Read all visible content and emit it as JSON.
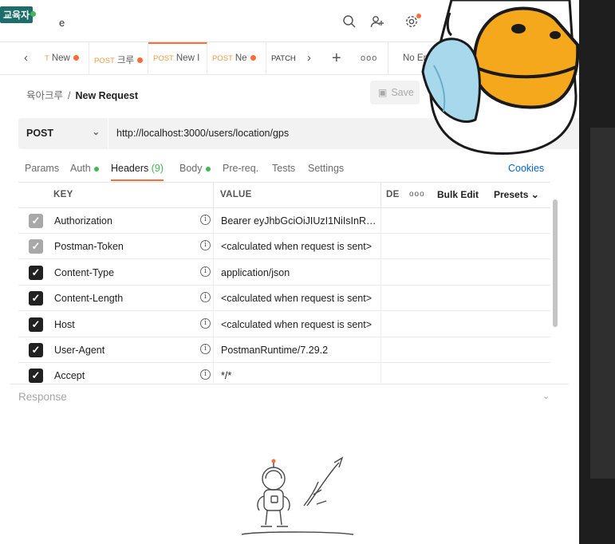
{
  "topbar": {
    "badge": "교육자",
    "title": "e",
    "icons": [
      "search-icon",
      "add-user-icon",
      "settings-icon"
    ]
  },
  "tabs": {
    "items": [
      {
        "method": "T",
        "title": "New",
        "dirty": true
      },
      {
        "method": "POST",
        "title": "크루",
        "dirty": true
      },
      {
        "method": "POST",
        "title": "New I",
        "dirty": false,
        "active": true
      },
      {
        "method": "POST",
        "title": "Ne",
        "dirty": true
      },
      {
        "method": "PATCH",
        "title": "",
        "dirty": false
      }
    ],
    "env_label": "No Env"
  },
  "breadcrumb": {
    "collection": "육아크루",
    "separator": "/",
    "current": "New Request"
  },
  "save_label": "Save",
  "request": {
    "method": "POST",
    "url": "http://localhost:3000/users/location/gps"
  },
  "request_tabs": [
    {
      "label": "Params"
    },
    {
      "label": "Auth",
      "dot": true
    },
    {
      "label": "Headers",
      "count": "(9)",
      "active": true
    },
    {
      "label": "Body",
      "dot": true
    },
    {
      "label": "Pre-req."
    },
    {
      "label": "Tests"
    },
    {
      "label": "Settings"
    }
  ],
  "cookies_label": "Cookies",
  "headers_table": {
    "columns": [
      "KEY",
      "VALUE",
      "DES"
    ],
    "bulk_edit": "Bulk Edit",
    "presets": "Presets",
    "rows": [
      {
        "key": "Authorization",
        "value": "Bearer eyJhbGciOiJIUzI1NiIsInR5...",
        "checked": true,
        "dim": true
      },
      {
        "key": "Postman-Token",
        "value": "<calculated when request is sent>",
        "checked": true,
        "dim": true
      },
      {
        "key": "Content-Type",
        "value": "application/json",
        "checked": true,
        "dim": false
      },
      {
        "key": "Content-Length",
        "value": "<calculated when request is sent>",
        "checked": true,
        "dim": false
      },
      {
        "key": "Host",
        "value": "<calculated when request is sent>",
        "checked": true,
        "dim": false
      },
      {
        "key": "User-Agent",
        "value": "PostmanRuntime/7.29.2",
        "checked": true,
        "dim": false
      },
      {
        "key": "Accept",
        "value": "*/*",
        "checked": true,
        "dim": false
      }
    ]
  },
  "response": {
    "title": "Response"
  },
  "colors": {
    "accent": "#ff6c37",
    "link": "#0265d2",
    "ok_dot": "#3fb950",
    "edu_badge": "#1b6e6b"
  }
}
